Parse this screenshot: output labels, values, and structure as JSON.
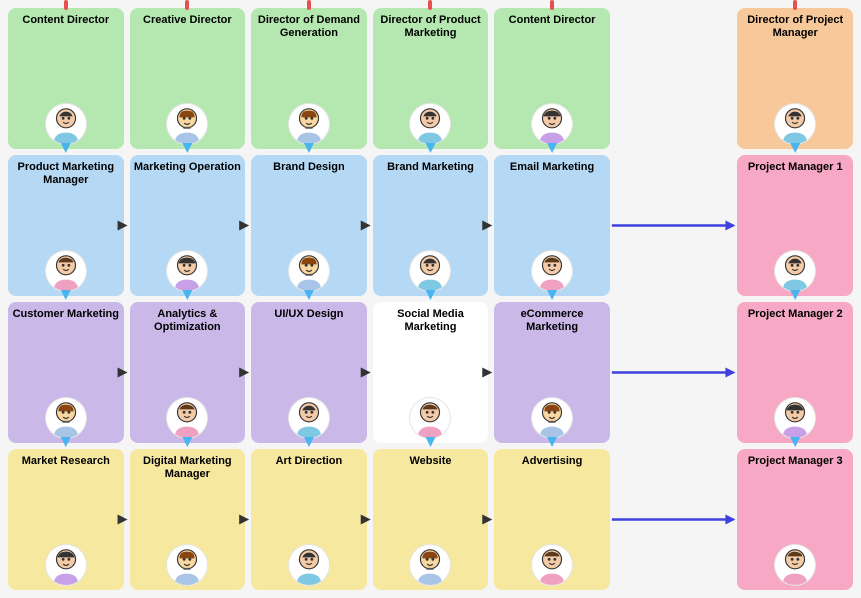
{
  "cards": [
    {
      "id": "c00",
      "row": 0,
      "col": 0,
      "title": "Content Director",
      "color": "green",
      "avatar": "👩",
      "hasTopIndicator": true
    },
    {
      "id": "c01",
      "row": 0,
      "col": 1,
      "title": "Creative Director",
      "color": "green",
      "avatar": "👨",
      "hasTopIndicator": true
    },
    {
      "id": "c02",
      "row": 0,
      "col": 2,
      "title": "Director of Demand Generation",
      "color": "green",
      "avatar": "👨",
      "hasTopIndicator": true
    },
    {
      "id": "c03",
      "row": 0,
      "col": 3,
      "title": "Director of Product Marketing",
      "color": "green",
      "avatar": "👩",
      "hasTopIndicator": true
    },
    {
      "id": "c04",
      "row": 0,
      "col": 4,
      "title": "Content Director",
      "color": "green",
      "avatar": "👨",
      "hasTopIndicator": true
    },
    {
      "id": "c05",
      "row": 0,
      "col": 5,
      "title": "",
      "color": "",
      "avatar": "",
      "hasTopIndicator": false
    },
    {
      "id": "c06",
      "row": 0,
      "col": 6,
      "title": "Director of Project Manager",
      "color": "orange",
      "avatar": "👩",
      "hasTopIndicator": true
    },
    {
      "id": "c10",
      "row": 1,
      "col": 0,
      "title": "Product Marketing Manager",
      "color": "blue",
      "avatar": "👩",
      "hasTopIndicator": false
    },
    {
      "id": "c11",
      "row": 1,
      "col": 1,
      "title": "Marketing Operation",
      "color": "blue",
      "avatar": "👨",
      "hasTopIndicator": false
    },
    {
      "id": "c12",
      "row": 1,
      "col": 2,
      "title": "Brand Design",
      "color": "blue",
      "avatar": "👨",
      "hasTopIndicator": false
    },
    {
      "id": "c13",
      "row": 1,
      "col": 3,
      "title": "Brand Marketing",
      "color": "blue",
      "avatar": "👩",
      "hasTopIndicator": false
    },
    {
      "id": "c14",
      "row": 1,
      "col": 4,
      "title": "Email Marketing",
      "color": "blue",
      "avatar": "👩",
      "hasTopIndicator": false
    },
    {
      "id": "c15",
      "row": 1,
      "col": 5,
      "title": "",
      "color": "",
      "avatar": "",
      "hasTopIndicator": false
    },
    {
      "id": "c16",
      "row": 1,
      "col": 6,
      "title": "Project Manager 1",
      "color": "pink",
      "avatar": "👩",
      "hasTopIndicator": false
    },
    {
      "id": "c20",
      "row": 2,
      "col": 0,
      "title": "Customer Marketing",
      "color": "purple",
      "avatar": "👨",
      "hasTopIndicator": false
    },
    {
      "id": "c21",
      "row": 2,
      "col": 1,
      "title": "Analytics & Optimization",
      "color": "purple",
      "avatar": "👩",
      "hasTopIndicator": false
    },
    {
      "id": "c22",
      "row": 2,
      "col": 2,
      "title": "UI/UX Design",
      "color": "purple",
      "avatar": "👩",
      "hasTopIndicator": false
    },
    {
      "id": "c23",
      "row": 2,
      "col": 3,
      "title": "Social Media Marketing",
      "color": "white-bg",
      "avatar": "👩",
      "hasTopIndicator": false
    },
    {
      "id": "c24",
      "row": 2,
      "col": 4,
      "title": "eCommerce Marketing",
      "color": "purple",
      "avatar": "👨",
      "hasTopIndicator": false
    },
    {
      "id": "c25",
      "row": 2,
      "col": 5,
      "title": "",
      "color": "",
      "avatar": "",
      "hasTopIndicator": false
    },
    {
      "id": "c26",
      "row": 2,
      "col": 6,
      "title": "Project Manager 2",
      "color": "pink",
      "avatar": "👨",
      "hasTopIndicator": false
    },
    {
      "id": "c30",
      "row": 3,
      "col": 0,
      "title": "Market Research",
      "color": "yellow",
      "avatar": "👨",
      "hasTopIndicator": false
    },
    {
      "id": "c31",
      "row": 3,
      "col": 1,
      "title": "Digital Marketing Manager",
      "color": "yellow",
      "avatar": "👨",
      "hasTopIndicator": false
    },
    {
      "id": "c32",
      "row": 3,
      "col": 2,
      "title": "Art Direction",
      "color": "yellow",
      "avatar": "👩",
      "hasTopIndicator": false
    },
    {
      "id": "c33",
      "row": 3,
      "col": 3,
      "title": "Website",
      "color": "yellow",
      "avatar": "👨",
      "hasTopIndicator": false
    },
    {
      "id": "c34",
      "row": 3,
      "col": 4,
      "title": "Advertising",
      "color": "yellow",
      "avatar": "👩",
      "hasTopIndicator": false
    },
    {
      "id": "c35",
      "row": 3,
      "col": 5,
      "title": "",
      "color": "",
      "avatar": "",
      "hasTopIndicator": false
    },
    {
      "id": "c36",
      "row": 3,
      "col": 6,
      "title": "Project Manager 3",
      "color": "pink",
      "avatar": "👩",
      "hasTopIndicator": false
    }
  ]
}
